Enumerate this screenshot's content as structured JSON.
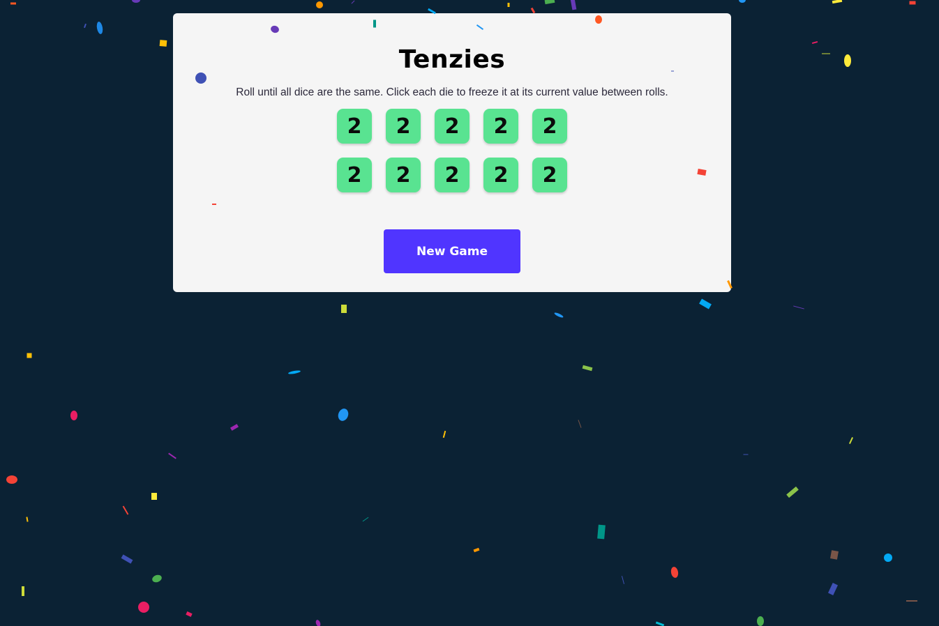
{
  "game": {
    "title": "Tenzies",
    "instructions": "Roll until all dice are the same. Click each die to freeze it at its current value between rolls.",
    "dice": [
      {
        "value": "2",
        "held": true
      },
      {
        "value": "2",
        "held": true
      },
      {
        "value": "2",
        "held": true
      },
      {
        "value": "2",
        "held": true
      },
      {
        "value": "2",
        "held": true
      },
      {
        "value": "2",
        "held": true
      },
      {
        "value": "2",
        "held": true
      },
      {
        "value": "2",
        "held": true
      },
      {
        "value": "2",
        "held": true
      },
      {
        "value": "2",
        "held": true
      }
    ],
    "new_game_label": "New Game",
    "state": "won"
  },
  "colors": {
    "background": "#0b2234",
    "card": "#f5f5f5",
    "held_die": "#59e391",
    "button": "#5035ff",
    "button_text": "#ffffff"
  }
}
